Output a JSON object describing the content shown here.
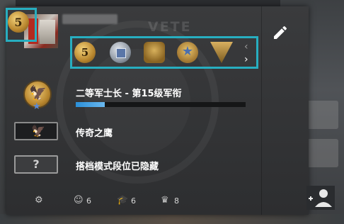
{
  "player": {
    "skill_coin_numeral": "5",
    "header_watermark": "VETE"
  },
  "medals": [
    {
      "name": "5-year-coin-icon",
      "glyph": "5"
    },
    {
      "name": "service-medal-icon",
      "glyph": ""
    },
    {
      "name": "operation-coin-icon",
      "glyph": ""
    },
    {
      "name": "veteran-coin-icon",
      "glyph": "★"
    },
    {
      "name": "triangle-pin-icon",
      "glyph": ""
    }
  ],
  "rank": {
    "title": "二等军士长 - 第15级军衔",
    "progress": 0.17
  },
  "skill_groups": {
    "competitive_label": "传奇之鹰",
    "wingman_label": "搭档模式段位已隐藏",
    "wingman_glyph": "?"
  },
  "commendations": {
    "friendly": "6",
    "teacher": "6",
    "leader": "8"
  },
  "colors": {
    "highlight": "#27aec0",
    "xp_bar": "#2a8fd8"
  }
}
